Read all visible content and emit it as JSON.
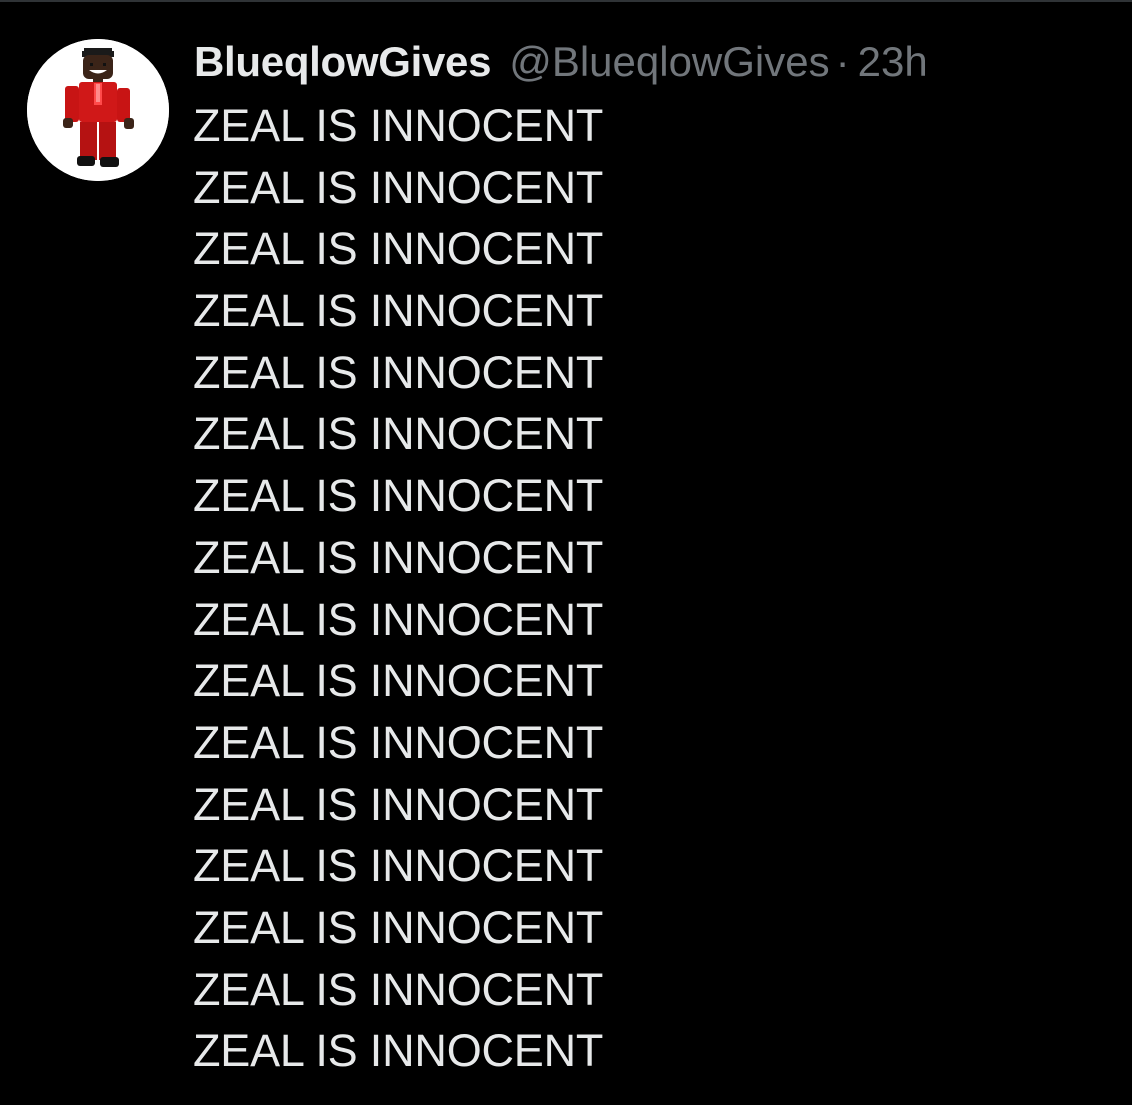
{
  "tweet": {
    "author": {
      "display_name": "BlueqlowGives",
      "handle": "@BlueqlowGives",
      "avatar_icon": "roblox-avatar-red-suit"
    },
    "separator": "·",
    "time": "23h",
    "lines": [
      "ZEAL IS INNOCENT",
      "ZEAL IS INNOCENT",
      "ZEAL IS INNOCENT",
      "ZEAL IS INNOCENT",
      "ZEAL IS INNOCENT",
      "ZEAL IS INNOCENT",
      "ZEAL IS INNOCENT",
      "ZEAL IS INNOCENT",
      "ZEAL IS INNOCENT",
      "ZEAL IS INNOCENT",
      "ZEAL IS INNOCENT",
      "ZEAL IS INNOCENT",
      "ZEAL IS INNOCENT",
      "ZEAL IS INNOCENT",
      "ZEAL IS INNOCENT",
      "ZEAL IS INNOCENT"
    ]
  },
  "colors": {
    "background": "#000000",
    "primary_text": "#e7e9ea",
    "secondary_text": "#71767b",
    "divider": "#2f3336"
  }
}
